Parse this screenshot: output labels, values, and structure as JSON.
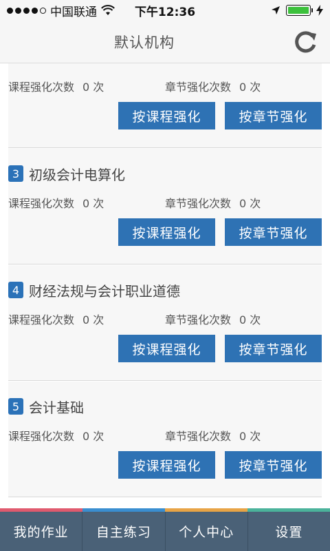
{
  "status_bar": {
    "carrier": "中国联通",
    "time": "下午12:36"
  },
  "header": {
    "title": "默认机构"
  },
  "labels": {
    "course_count": "课程强化次数",
    "chapter_count": "章节强化次数",
    "by_course": "按课程强化",
    "by_chapter": "按章节强化"
  },
  "courses": [
    {
      "number": "",
      "title": "",
      "course_count": "0 次",
      "chapter_count": "0 次"
    },
    {
      "number": "3",
      "title": "初级会计电算化",
      "course_count": "0 次",
      "chapter_count": "0 次"
    },
    {
      "number": "4",
      "title": "财经法规与会计职业道德",
      "course_count": "0 次",
      "chapter_count": "0 次"
    },
    {
      "number": "5",
      "title": "会计基础",
      "course_count": "0 次",
      "chapter_count": "0 次"
    }
  ],
  "tabs": [
    {
      "label": "我的作业",
      "color": "#e05a6e"
    },
    {
      "label": "自主练习",
      "color": "#3a8ed0"
    },
    {
      "label": "个人中心",
      "color": "#e8a446"
    },
    {
      "label": "设置",
      "color": "#4bb39b"
    }
  ],
  "colors": {
    "accent": "#2e72b4",
    "tab_bar": "#4a6177",
    "battery": "#3cc13c"
  }
}
